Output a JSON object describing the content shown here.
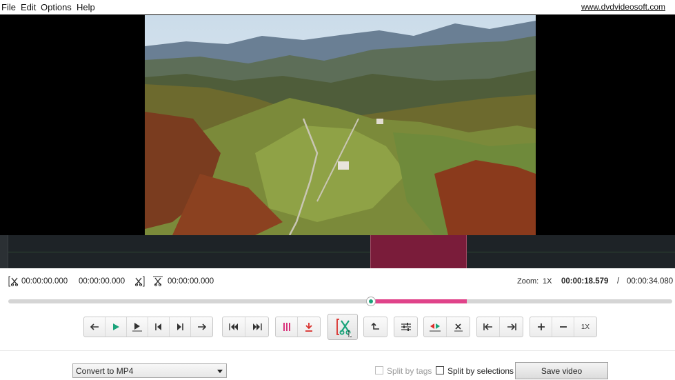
{
  "menu": {
    "file": "File",
    "edit": "Edit",
    "options": "Options",
    "help": "Help",
    "website": "www.dvdvideosoft.com"
  },
  "info": {
    "start_time": "00:00:00.000",
    "end_time": "00:00:00.000",
    "segment_time": "00:00:00.000",
    "zoom_label": "Zoom:",
    "zoom_value": "1X",
    "current_time": "00:00:18.579",
    "separator": "/",
    "total_time": "00:00:34.080"
  },
  "playback": {
    "position_fraction": 0.545,
    "selection_start_fraction": 0.545,
    "selection_end_fraction": 0.69
  },
  "zoom_controls": {
    "reset_label": "1X"
  },
  "output": {
    "format_selected": "Convert to MP4",
    "split_by_tags_label": "Split by tags",
    "split_by_tags_checked": false,
    "split_by_tags_enabled": false,
    "split_by_selections_label": "Split by selections",
    "split_by_selections_checked": false,
    "save_label": "Save video"
  },
  "colors": {
    "accent": "#e0438a",
    "selection": "#7a1c3a",
    "play_green": "#1aa37a",
    "cut_red": "#d9302c"
  }
}
